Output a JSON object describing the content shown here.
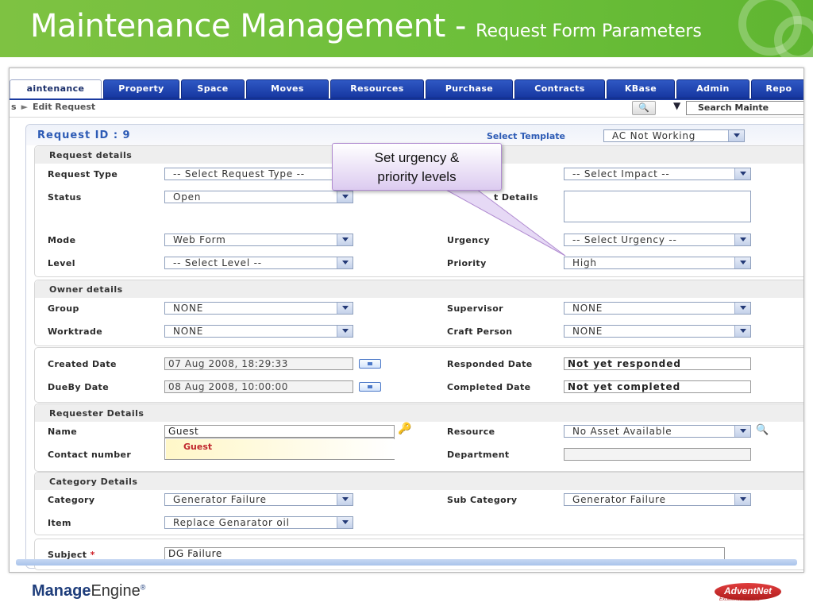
{
  "slide": {
    "title": "Maintenance Management - ",
    "subtitle": "Request Form Parameters",
    "footer_brand_bold": "Manage",
    "footer_brand_light": "Engine",
    "footer_brand_mark": "®",
    "footer_partner": "AdventNet",
    "footer_partner_tagline": "Excellence Matters"
  },
  "tabs": [
    {
      "label": "aintenance",
      "active": true
    },
    {
      "label": "Property"
    },
    {
      "label": "Space"
    },
    {
      "label": "Moves"
    },
    {
      "label": "Resources"
    },
    {
      "label": "Purchase"
    },
    {
      "label": "Contracts"
    },
    {
      "label": "KBase"
    },
    {
      "label": "Admin"
    },
    {
      "label": "Repo"
    }
  ],
  "breadcrumb": {
    "prefix": "s",
    "separator": "►",
    "current": "Edit Request"
  },
  "search": {
    "placeholder": "Search Mainte"
  },
  "form": {
    "request_id": "Request ID : 9",
    "template_label": "Select Template",
    "template_value": "AC Not Working",
    "sections": {
      "request_details": "Request details",
      "owner_details": "Owner details",
      "requester_details": "Requester Details",
      "category_details": "Category Details"
    },
    "fields": {
      "request_type": {
        "label": "Request Type",
        "value": "-- Select Request Type --"
      },
      "impact": {
        "value": "-- Select Impact --"
      },
      "status": {
        "label": "Status",
        "value": "Open"
      },
      "impact_details": {
        "label_fragment": "t Details"
      },
      "mode": {
        "label": "Mode",
        "value": "Web Form"
      },
      "urgency": {
        "label": "Urgency",
        "value": "-- Select Urgency --"
      },
      "level": {
        "label": "Level",
        "value": "-- Select Level --"
      },
      "priority": {
        "label": "Priority",
        "value": "High"
      },
      "group": {
        "label": "Group",
        "value": "NONE"
      },
      "supervisor": {
        "label": "Supervisor",
        "value": "NONE"
      },
      "worktrade": {
        "label": "Worktrade",
        "value": "NONE"
      },
      "craft_person": {
        "label": "Craft Person",
        "value": "NONE"
      },
      "created_date": {
        "label": "Created Date",
        "value": "07 Aug 2008, 18:29:33"
      },
      "responded_date": {
        "label": "Responded Date",
        "value": "Not yet responded"
      },
      "dueby_date": {
        "label": "DueBy Date",
        "value": "08 Aug 2008, 10:00:00"
      },
      "completed_date": {
        "label": "Completed Date",
        "value": "Not yet completed"
      },
      "name": {
        "label": "Name",
        "value": "Guest",
        "suggestion": "Guest"
      },
      "resource": {
        "label": "Resource",
        "value": "No Asset Available"
      },
      "contact_number": {
        "label": "Contact number"
      },
      "department": {
        "label": "Department",
        "value": ""
      },
      "category": {
        "label": "Category",
        "value": "Generator Failure"
      },
      "sub_category": {
        "label": "Sub Category",
        "value": "Generator Failure"
      },
      "item": {
        "label": "Item",
        "value": "Replace Genarator oil"
      },
      "subject": {
        "label": "Subject",
        "required_mark": "*",
        "value": "DG Failure"
      }
    }
  },
  "callout": {
    "line1": "Set urgency &",
    "line2": "priority levels"
  },
  "colors": {
    "header_green": "#6cbf3a",
    "tab_blue": "#1e44b2",
    "label_blue": "#2d5bb5",
    "callout_purple": "#dccbf0"
  },
  "icons": [
    "search-icon",
    "calendar-icon",
    "key-icon",
    "asset-lookup-icon",
    "dropdown-arrow-icon"
  ]
}
